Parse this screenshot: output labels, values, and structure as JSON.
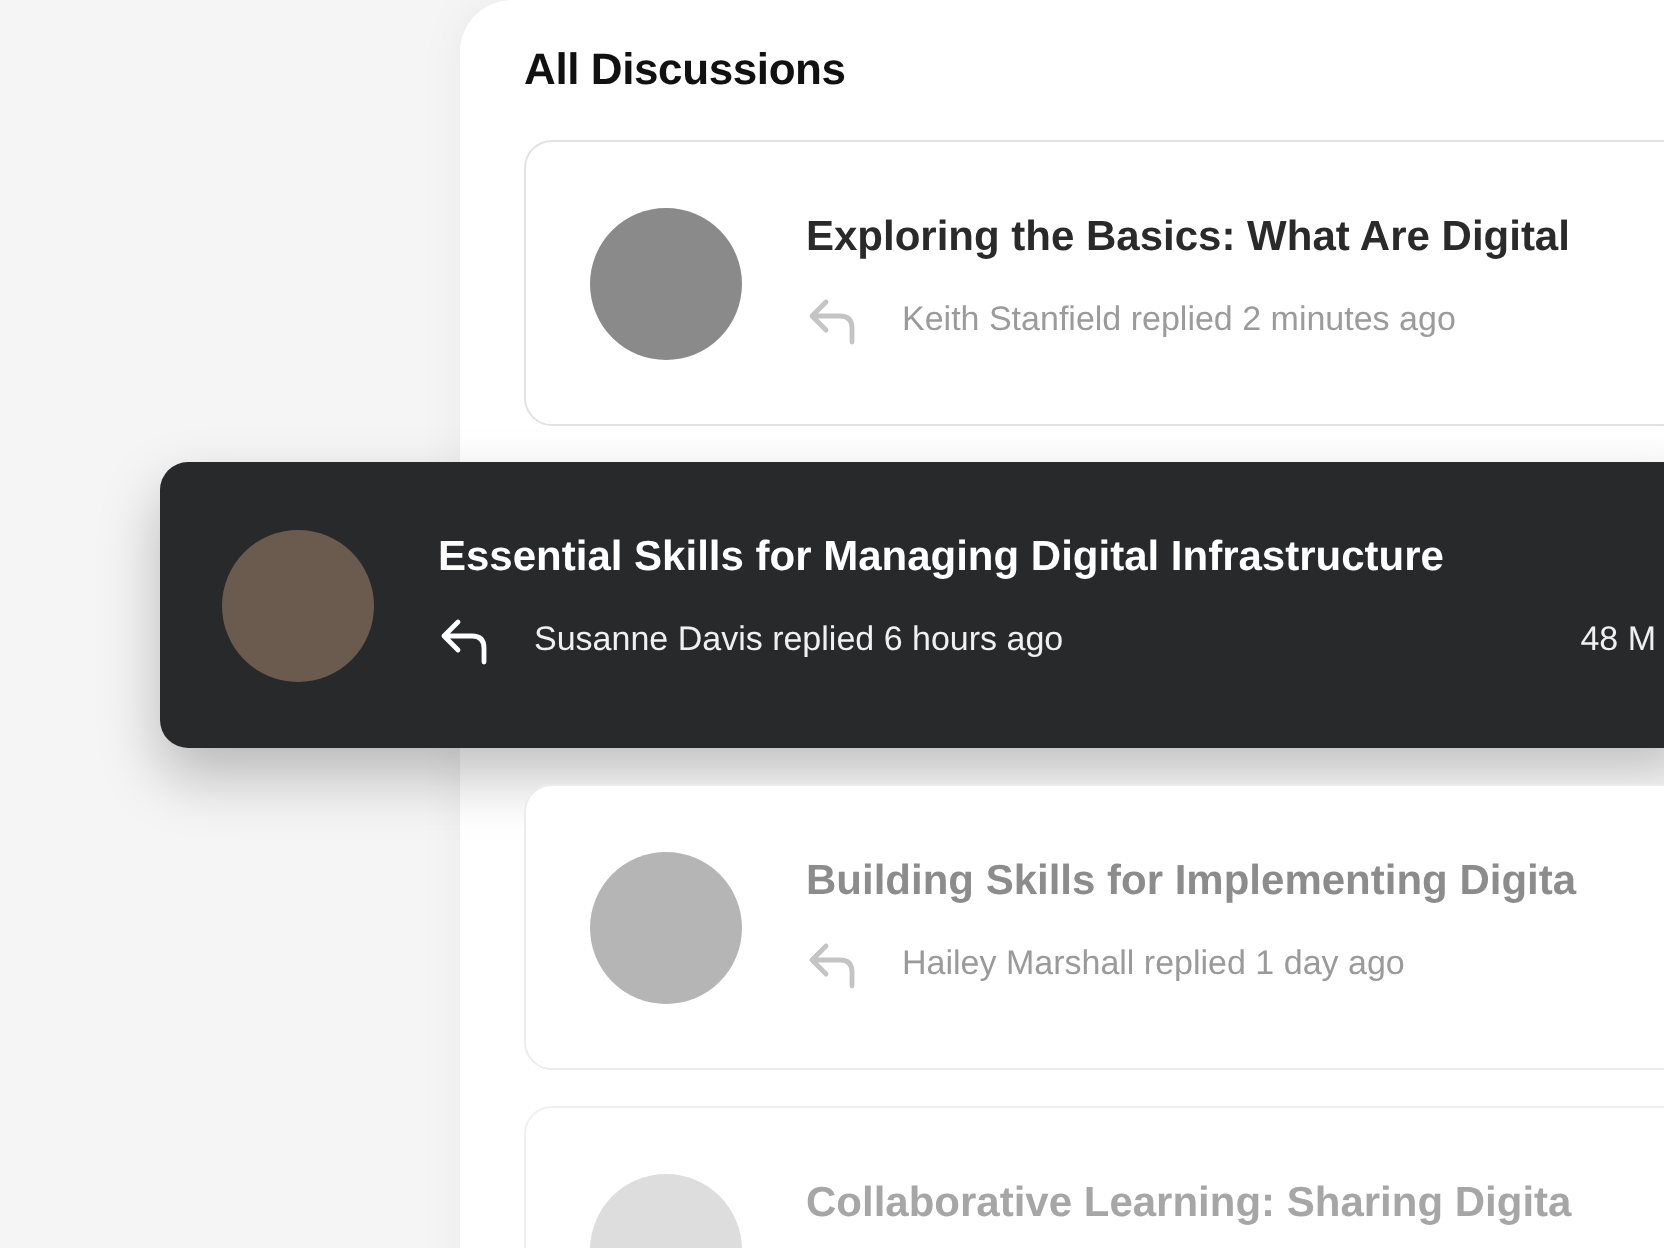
{
  "heading": "All Discussions",
  "discussions": [
    {
      "title": "Exploring the Basics: What Are Digital",
      "activity": "Keith Stanfield replied 2 minutes ago",
      "highlighted": false
    },
    {
      "title": "Essential Skills for Managing Digital Infrastructure",
      "activity": "Susanne Davis replied 6 hours ago",
      "count": "48 M",
      "highlighted": true
    },
    {
      "title": "Building Skills for Implementing Digita",
      "activity": "Hailey Marshall replied 1 day ago",
      "highlighted": false
    },
    {
      "title": "Collaborative Learning: Sharing Digita",
      "highlighted": false
    }
  ]
}
